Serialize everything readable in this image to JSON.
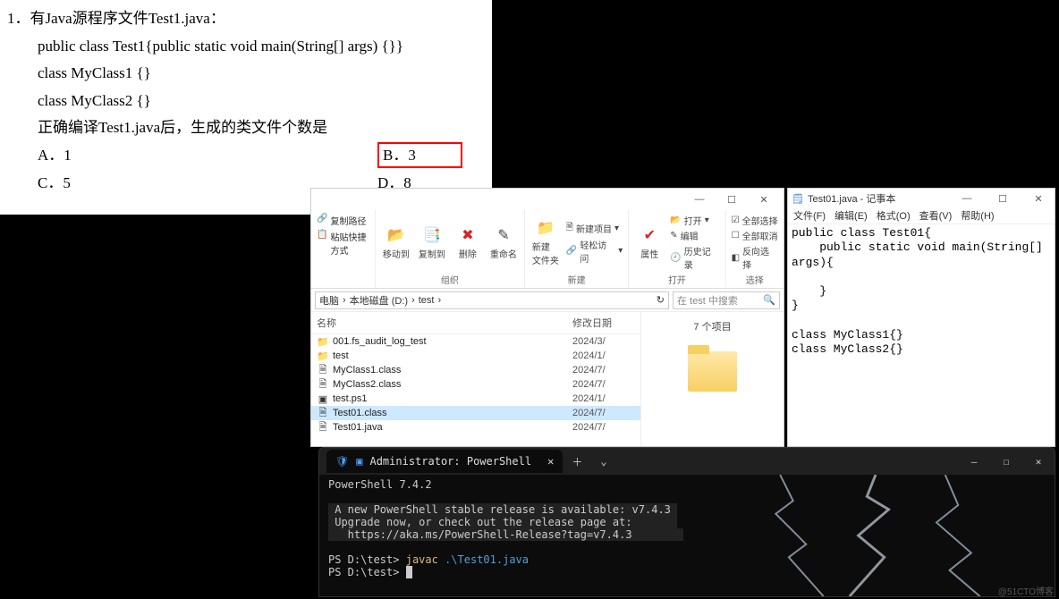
{
  "question": {
    "number": "1．",
    "prompt": "有Java源程序文件Test1.java：",
    "code1": "public class Test1{public static void main(String[] args) {}}",
    "code2": "class MyClass1 {}",
    "code3": "class MyClass2 {}",
    "after": "正确编译Test1.java后，生成的类文件个数是",
    "optA": "A．1",
    "optB": "B．3",
    "optC": "C．5",
    "optD": "D．8"
  },
  "explorer": {
    "clip_board": {
      "copy_path": "复制路径",
      "paste_shortcut": "粘贴快捷方式"
    },
    "organize": {
      "move_to": "移动到",
      "copy_to": "复制到",
      "delete": "删除",
      "rename": "重命名",
      "label": "组织"
    },
    "new_group": {
      "new_folder": "新建\n文件夹",
      "new_item": "新建项目",
      "easy_access": "轻松访问",
      "label": "新建"
    },
    "open_group": {
      "properties": "属性",
      "open": "打开",
      "edit": "编辑",
      "history": "历史记录",
      "label": "打开"
    },
    "select_group": {
      "select_all": "全部选择",
      "select_none": "全部取消",
      "invert": "反向选择",
      "label": "选择"
    },
    "breadcrumb": [
      "电脑",
      "本地磁盘 (D:)",
      "test"
    ],
    "search_placeholder": "在 test 中搜索",
    "columns": {
      "name": "名称",
      "date": "修改日期"
    },
    "preview_count": "7 个项目",
    "files": [
      {
        "icon": "folder",
        "name": "001.fs_audit_log_test",
        "date": "2024/3/"
      },
      {
        "icon": "folder",
        "name": "test",
        "date": "2024/1/"
      },
      {
        "icon": "file",
        "name": "MyClass1.class",
        "date": "2024/7/"
      },
      {
        "icon": "file",
        "name": "MyClass2.class",
        "date": "2024/7/"
      },
      {
        "icon": "ps1",
        "name": "test.ps1",
        "date": "2024/1/"
      },
      {
        "icon": "file",
        "name": "Test01.class",
        "date": "2024/7/",
        "selected": true
      },
      {
        "icon": "file",
        "name": "Test01.java",
        "date": "2024/7/"
      }
    ]
  },
  "notepad": {
    "title": "Test01.java - 记事本",
    "menu": {
      "file": "文件(F)",
      "edit": "编辑(E)",
      "format": "格式(O)",
      "view": "查看(V)",
      "help": "帮助(H)"
    },
    "content": "public class Test01{\n    public static void main(String[]\nargs){\n\n    }\n}\n\nclass MyClass1{}\nclass MyClass2{}"
  },
  "terminal": {
    "tab_title": "Administrator: PowerShell",
    "version_line": "PowerShell 7.4.2",
    "notice1": " A new PowerShell stable release is available: v7.4.3 ",
    "notice2": " Upgrade now, or check out the release page at:       ",
    "notice3": "   https://aka.ms/PowerShell-Release?tag=v7.4.3        ",
    "prompt1_path": "PS D:\\test>",
    "prompt1_cmd": "javac",
    "prompt1_arg": ".\\Test01.java",
    "prompt2_path": "PS D:\\test>"
  },
  "watermark": "@51CTO博客"
}
